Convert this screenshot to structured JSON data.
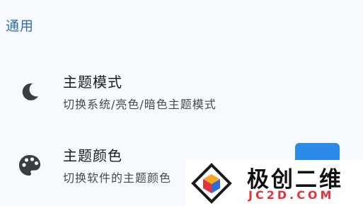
{
  "section": {
    "title": "通用"
  },
  "settings": [
    {
      "id": "theme-mode",
      "icon": "moon-icon",
      "title": "主题模式",
      "subtitle": "切换系统/亮色/暗色主题模式"
    },
    {
      "id": "theme-color",
      "icon": "palette-icon",
      "title": "主题颜色",
      "subtitle": "切换软件的主题颜色",
      "swatch_color": "#2b8be8"
    }
  ],
  "watermark": {
    "title": "极创二维",
    "url": "JC2D.COM",
    "url_color": "#e0343f"
  },
  "colors": {
    "background": "#f6f9fd",
    "section_header": "#2f6ea8",
    "icon": "#3a3d42"
  }
}
